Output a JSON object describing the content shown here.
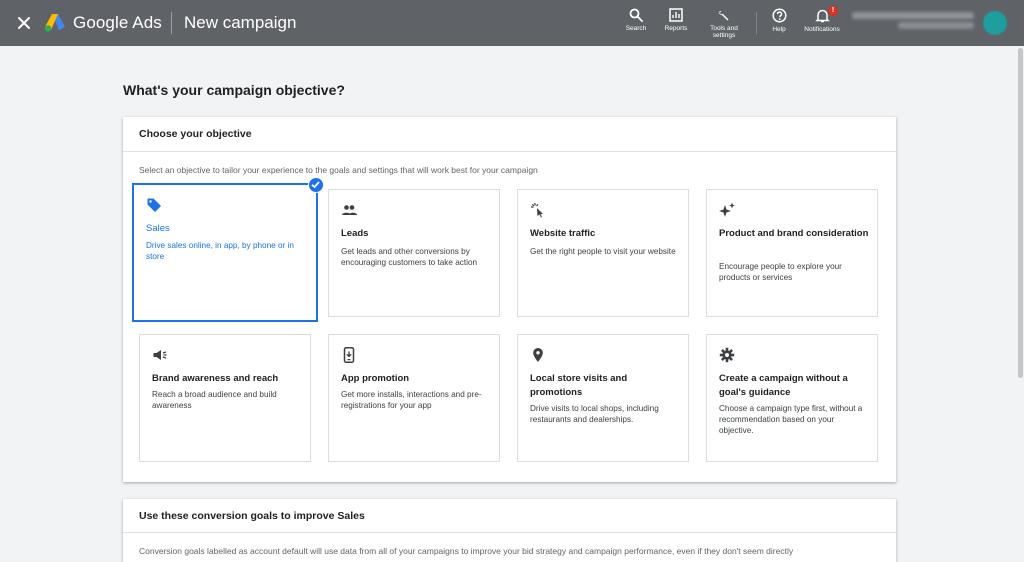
{
  "topbar": {
    "brand": "Google Ads",
    "page_title": "New campaign",
    "tools": [
      {
        "label": "Search",
        "icon": "search-icon"
      },
      {
        "label": "Reports",
        "icon": "reports-icon"
      },
      {
        "label": "Tools and settings",
        "icon": "wrench-icon"
      },
      {
        "label": "Help",
        "icon": "help-icon"
      },
      {
        "label": "Notifications",
        "icon": "bell-icon",
        "badge": "!"
      }
    ]
  },
  "main": {
    "heading": "What's your campaign objective?",
    "objective_card": {
      "title": "Choose your objective",
      "subtitle": "Select an objective to tailor your experience to the goals and settings that will work best for your campaign",
      "objectives": [
        {
          "title": "Sales",
          "description": "Drive sales online, in app, by phone or in store",
          "icon": "tag-icon",
          "selected": true
        },
        {
          "title": "Leads",
          "description": "Get leads and other conversions by encouraging customers to take action",
          "icon": "people-icon",
          "selected": false
        },
        {
          "title": "Website traffic",
          "description": "Get the right people to visit your website",
          "icon": "cursor-click-icon",
          "selected": false
        },
        {
          "title": "Product and brand consideration",
          "description": "Encourage people to explore your products or services",
          "icon": "sparkle-icon",
          "selected": false
        },
        {
          "title": "Brand awareness and reach",
          "description": "Reach a broad audience and build awareness",
          "icon": "megaphone-icon",
          "selected": false
        },
        {
          "title": "App promotion",
          "description": "Get more installs, interactions and pre-registrations for your app",
          "icon": "phone-icon",
          "selected": false
        },
        {
          "title": "Local store visits and promotions",
          "description": "Drive visits to local shops, including restaurants and dealerships.",
          "icon": "location-pin-icon",
          "selected": false
        },
        {
          "title": "Create a campaign without a goal's guidance",
          "description": "Choose a campaign type first, without a recommendation based on your objective.",
          "icon": "gear-icon",
          "selected": false
        }
      ]
    },
    "conversion_card": {
      "title": "Use these conversion goals to improve Sales",
      "text": "Conversion goals labelled as account default will use data from all of your campaigns to improve your bid strategy and campaign performance, even if they don't seem directly"
    }
  },
  "colors": {
    "topbar": "#5f6368",
    "accent": "#1a73e8",
    "background": "#f1f3f4"
  }
}
